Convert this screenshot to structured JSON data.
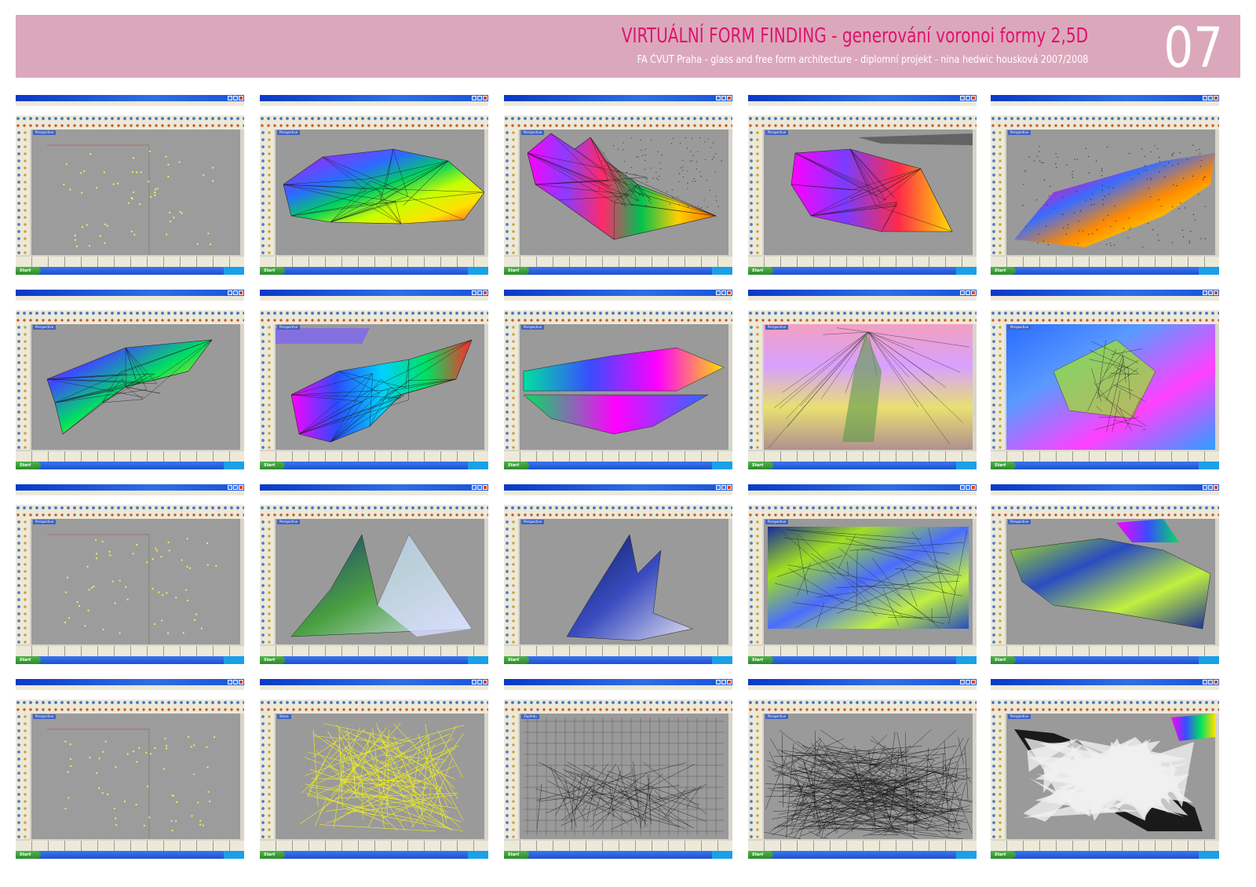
{
  "header": {
    "title": "VIRTUÁLNÍ FORM FINDING - generování voronoi formy 2,5D",
    "subtitle": "FA ČVUT Praha - glass and free form architecture  - diplomní projekt - nina hedwic housková 2007/2008",
    "page_number": "07"
  },
  "colors": {
    "header_bg": "#dba8bb",
    "title": "#e0136d",
    "viewport_bg": "#9a9a9a",
    "xp_blue": "#2f6ee6",
    "start_green": "#3fa03b"
  },
  "screens": [
    {
      "label": "Perspective",
      "taskbar": "Start",
      "content": "points"
    },
    {
      "label": "Perspective",
      "taskbar": "Start",
      "content": "rainbow-mesh"
    },
    {
      "label": "Perspective",
      "taskbar": "Start",
      "content": "rainbow-spikes"
    },
    {
      "label": "Perspective",
      "taskbar": "Start",
      "content": "rainbow-folded"
    },
    {
      "label": "Perspective",
      "taskbar": "Start",
      "content": "orange-voronoi"
    },
    {
      "label": "Perspective",
      "taskbar": "Start",
      "content": "rainbow-wing"
    },
    {
      "label": "Perspective",
      "taskbar": "Start",
      "content": "blue-spikes"
    },
    {
      "label": "Perspective",
      "taskbar": "Start",
      "content": "rainbow-flat"
    },
    {
      "label": "Perspective",
      "taskbar": "Start",
      "content": "pink-interior"
    },
    {
      "label": "Perspective",
      "taskbar": "Start",
      "content": "blue-interior"
    },
    {
      "label": "Perspective",
      "taskbar": "Start",
      "content": "points"
    },
    {
      "label": "Perspective",
      "taskbar": "Start",
      "content": "green-peaks"
    },
    {
      "label": "Perspective",
      "taskbar": "Start",
      "content": "dark-spikes"
    },
    {
      "label": "Perspective",
      "taskbar": "Start",
      "content": "green-blue-mesh"
    },
    {
      "label": "Perspective",
      "taskbar": "Start",
      "content": "green-blue-landscape"
    },
    {
      "label": "Perspective",
      "taskbar": "Start",
      "content": "points"
    },
    {
      "label": "Shora",
      "taskbar": "Start",
      "content": "yellow-wire"
    },
    {
      "label": "Zepředu",
      "taskbar": "Start",
      "content": "grid-wire"
    },
    {
      "label": "Perspective",
      "taskbar": "Start",
      "content": "black-wire"
    },
    {
      "label": "Perspective",
      "taskbar": "Start",
      "content": "bw-shard"
    }
  ]
}
